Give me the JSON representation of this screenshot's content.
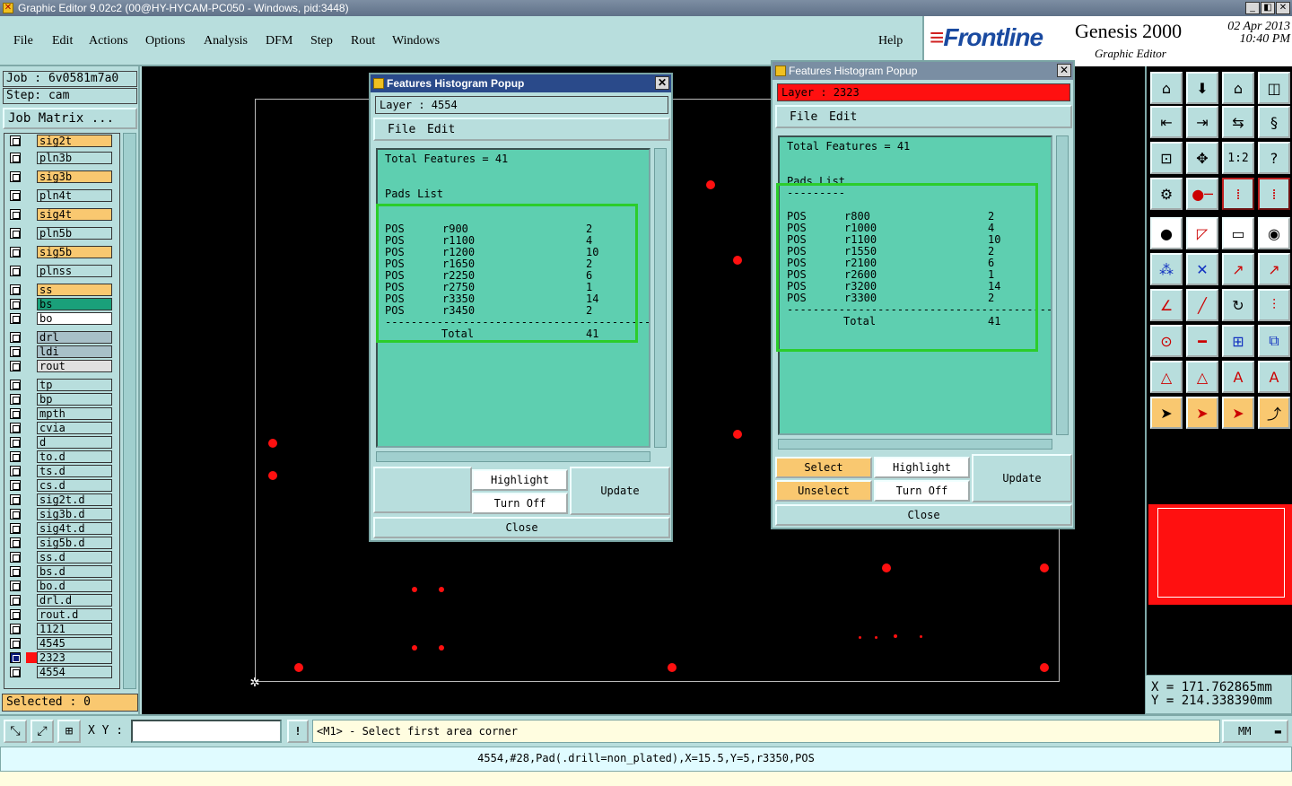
{
  "window": {
    "title": "Graphic Editor 9.02c2 (00@HY-HYCAM-PC050 - Windows, pid:3448)",
    "minimize": "_",
    "maximize": "◧",
    "close": "✕"
  },
  "menu": {
    "items": [
      "File",
      "Edit",
      "Actions",
      "Options",
      "Analysis",
      "DFM",
      "Step",
      "Rout",
      "Windows"
    ],
    "help": "Help"
  },
  "brand": {
    "logo": "Frontline",
    "product": "Genesis 2000",
    "subtitle": "Graphic Editor",
    "date": "02  Apr 2013",
    "time": "10:40 PM"
  },
  "job": {
    "job_label": "Job : 6v0581m7a0",
    "step_label": "Step: cam",
    "matrix_button": "Job Matrix ..."
  },
  "layers": [
    {
      "name": "sig2t",
      "color": "#f9c870"
    },
    {
      "name": "pln3b",
      "color": "#b8dedd"
    },
    {
      "name": "sig3b",
      "color": "#f9c870"
    },
    {
      "name": "pln4t",
      "color": "#b8dedd"
    },
    {
      "name": "sig4t",
      "color": "#f9c870"
    },
    {
      "name": "pln5b",
      "color": "#b8dedd"
    },
    {
      "name": "sig5b",
      "color": "#f9c870"
    },
    {
      "name": "plnss",
      "color": "#b8dedd"
    },
    {
      "name": "ss",
      "color": "#f9c870"
    },
    {
      "name": "bs",
      "color": "#1aa07a"
    },
    {
      "name": "bo",
      "color": "#ffffff"
    },
    {
      "name": "drl",
      "color": "#a8c0c8"
    },
    {
      "name": "ldi",
      "color": "#a8c0c8"
    },
    {
      "name": "rout",
      "color": "#e0e0e0"
    },
    {
      "name": "tp",
      "color": "#b8dedd"
    },
    {
      "name": "bp",
      "color": "#b8dedd"
    },
    {
      "name": "mpth",
      "color": "#b8dedd"
    },
    {
      "name": "cvia",
      "color": "#b8dedd"
    },
    {
      "name": "d",
      "color": "#b8dedd"
    },
    {
      "name": "to.d",
      "color": "#b8dedd"
    },
    {
      "name": "ts.d",
      "color": "#b8dedd"
    },
    {
      "name": "cs.d",
      "color": "#b8dedd"
    },
    {
      "name": "sig2t.d",
      "color": "#b8dedd"
    },
    {
      "name": "sig3b.d",
      "color": "#b8dedd"
    },
    {
      "name": "sig4t.d",
      "color": "#b8dedd"
    },
    {
      "name": "sig5b.d",
      "color": "#b8dedd"
    },
    {
      "name": "ss.d",
      "color": "#b8dedd"
    },
    {
      "name": "bs.d",
      "color": "#b8dedd"
    },
    {
      "name": "bo.d",
      "color": "#b8dedd"
    },
    {
      "name": "drl.d",
      "color": "#b8dedd"
    },
    {
      "name": "rout.d",
      "color": "#b8dedd"
    },
    {
      "name": "1121",
      "color": "#b8dedd"
    },
    {
      "name": "4545",
      "color": "#b8dedd"
    },
    {
      "name": "2323",
      "color": "#b8dedd",
      "active": true,
      "swatch": "#ff1010"
    },
    {
      "name": "4554",
      "color": "#b8dedd"
    }
  ],
  "selected_label": "Selected : 0",
  "popup1": {
    "title": "Features Histogram Popup",
    "layer_label": "Layer :  4554",
    "menu": [
      "File",
      "Edit"
    ],
    "total": "Total Features = 41",
    "pads_heading": "Pads List",
    "rows": [
      {
        "pol": "POS",
        "sym": "r900",
        "count": "2"
      },
      {
        "pol": "POS",
        "sym": "r1100",
        "count": "4"
      },
      {
        "pol": "POS",
        "sym": "r1200",
        "count": "10"
      },
      {
        "pol": "POS",
        "sym": "r1650",
        "count": "2"
      },
      {
        "pol": "POS",
        "sym": "r2250",
        "count": "6"
      },
      {
        "pol": "POS",
        "sym": "r2750",
        "count": "1"
      },
      {
        "pol": "POS",
        "sym": "r3350",
        "count": "14"
      },
      {
        "pol": "POS",
        "sym": "r3450",
        "count": "2"
      }
    ],
    "total_label": "Total",
    "total_value": "41",
    "highlight": "Highlight",
    "turn_off": "Turn Off",
    "update": "Update",
    "close": "Close"
  },
  "popup2": {
    "title": "Features Histogram Popup",
    "layer_label": "Layer :  2323",
    "menu": [
      "File",
      "Edit"
    ],
    "total": "Total Features = 41",
    "pads_heading": "Pads List",
    "rows": [
      {
        "pol": "POS",
        "sym": "r800",
        "count": "2"
      },
      {
        "pol": "POS",
        "sym": "r1000",
        "count": "4"
      },
      {
        "pol": "POS",
        "sym": "r1100",
        "count": "10"
      },
      {
        "pol": "POS",
        "sym": "r1550",
        "count": "2"
      },
      {
        "pol": "POS",
        "sym": "r2100",
        "count": "6"
      },
      {
        "pol": "POS",
        "sym": "r2600",
        "count": "1"
      },
      {
        "pol": "POS",
        "sym": "r3200",
        "count": "14"
      },
      {
        "pol": "POS",
        "sym": "r3300",
        "count": "2"
      }
    ],
    "total_label": "Total",
    "total_value": "41",
    "select": "Select",
    "unselect": "Unselect",
    "highlight": "Highlight",
    "turn_off": "Turn Off",
    "update": "Update",
    "close": "Close"
  },
  "tools": {
    "one_two": "1:2",
    "help_q": "?"
  },
  "coords": {
    "x": "X  =  171.762865mm",
    "y": "Y  =  214.338390mm"
  },
  "status": {
    "xy_label": "X Y :",
    "xy_value": "",
    "alert": "!",
    "prompt": "<M1> - Select first area corner",
    "units": "MM"
  },
  "message": "4554,#28,Pad(.drill=non_plated),X=15.5,Y=5,r3350,POS",
  "colors": {
    "panel": "#b8dedd",
    "canvas": "#000000",
    "pad": "#ff1010",
    "highlight_box": "#2bcd2b",
    "active_layer": "#ff1010"
  }
}
